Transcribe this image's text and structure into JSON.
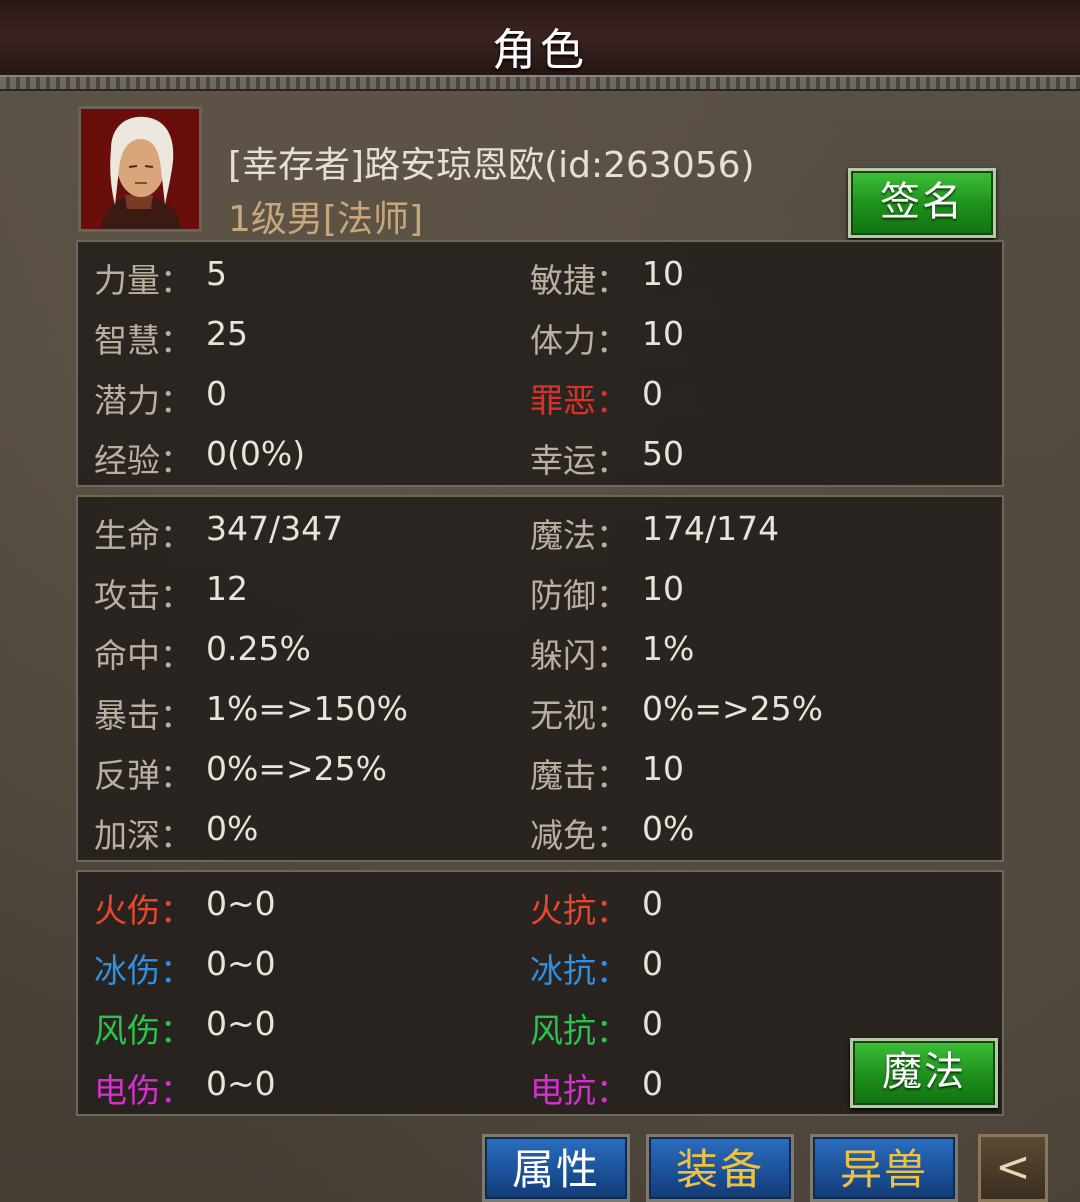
{
  "window": {
    "title": "角色"
  },
  "character": {
    "name": "[幸存者]路安琼恩欧(id:263056)",
    "level_line": "1级男[法师]",
    "sign_button": "签名"
  },
  "base_stats": [
    {
      "left_label": "力量：",
      "left_value": "5",
      "right_label": "敏捷：",
      "right_value": "10"
    },
    {
      "left_label": "智慧：",
      "left_value": "25",
      "right_label": "体力：",
      "right_value": "10"
    },
    {
      "left_label": "潜力：",
      "left_value": "0",
      "right_label": "罪恶：",
      "right_value": "0"
    },
    {
      "left_label": "经验：",
      "left_value": "0(0%)",
      "right_label": "幸运：",
      "right_value": "50"
    }
  ],
  "combat_stats": [
    {
      "left_label": "生命：",
      "left_value": "347/347",
      "right_label": "魔法：",
      "right_value": "174/174"
    },
    {
      "left_label": "攻击：",
      "left_value": "12",
      "right_label": "防御：",
      "right_value": "10"
    },
    {
      "left_label": "命中：",
      "left_value": "0.25%",
      "right_label": "躲闪：",
      "right_value": "1%"
    },
    {
      "left_label": "暴击：",
      "left_value": "1%=>150%",
      "right_label": "无视：",
      "right_value": "0%=>25%"
    },
    {
      "left_label": "反弹：",
      "left_value": "0%=>25%",
      "right_label": "魔击：",
      "right_value": "10"
    },
    {
      "left_label": "加深：",
      "left_value": "0%",
      "right_label": "减免：",
      "right_value": "0%"
    }
  ],
  "element_stats": [
    {
      "left_label": "火伤：",
      "left_value": "0~0",
      "right_label": "火抗：",
      "right_value": "0"
    },
    {
      "left_label": "冰伤：",
      "left_value": "0~0",
      "right_label": "冰抗：",
      "right_value": "0"
    },
    {
      "left_label": "风伤：",
      "left_value": "0~0",
      "right_label": "风抗：",
      "right_value": "0"
    },
    {
      "left_label": "电伤：",
      "left_value": "0~0",
      "right_label": "电抗：",
      "right_value": "0"
    }
  ],
  "magic_button": "魔法",
  "tabs": [
    {
      "label": "属性"
    },
    {
      "label": "装备"
    },
    {
      "label": "异兽"
    }
  ],
  "back_button": "<",
  "colors": {
    "sin_label": "#d8322a",
    "fire": "#e8472e",
    "ice": "#2f8fe0",
    "wind": "#27c64a",
    "electric": "#d52fd0",
    "tab_active_text": "#ffffff",
    "tab_inactive_text": "#f0c040"
  }
}
